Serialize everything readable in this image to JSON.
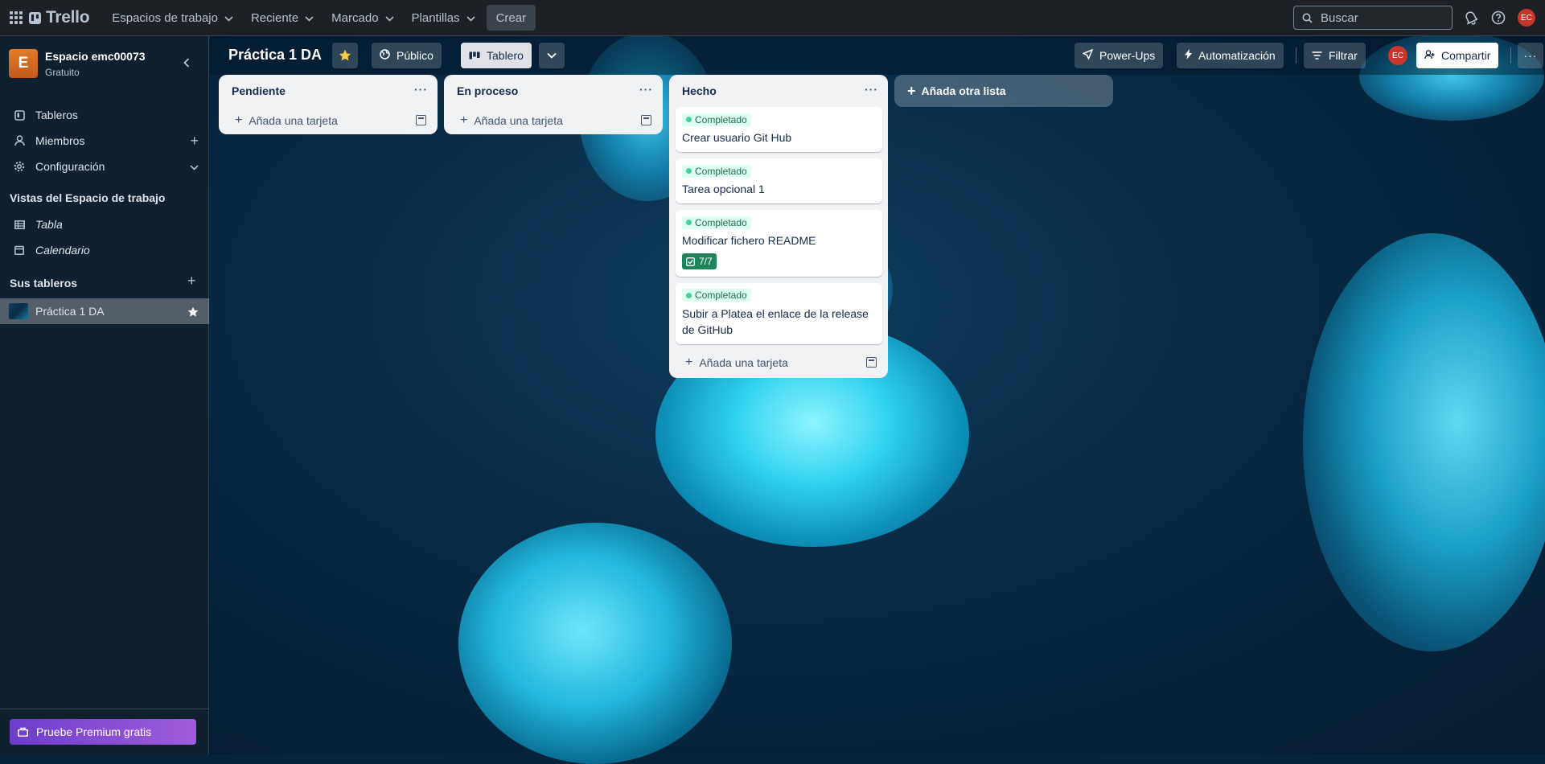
{
  "topnav": {
    "logo": "Trello",
    "menus": [
      "Espacios de trabajo",
      "Reciente",
      "Marcado",
      "Plantillas"
    ],
    "create_label": "Crear",
    "search_placeholder": "Buscar",
    "user_initials": "EC"
  },
  "sidebar": {
    "workspace_initial": "E",
    "workspace_name": "Espacio emc00073",
    "workspace_plan": "Gratuito",
    "items": [
      {
        "label": "Tableros",
        "icon": "board-icon"
      },
      {
        "label": "Miembros",
        "icon": "person-icon"
      },
      {
        "label": "Configuración",
        "icon": "gear-icon"
      }
    ],
    "views_heading": "Vistas del Espacio de trabajo",
    "views": [
      {
        "label": "Tabla",
        "icon": "table-icon"
      },
      {
        "label": "Calendario",
        "icon": "calendar-icon"
      }
    ],
    "boards_heading": "Sus tableros",
    "boards": [
      {
        "label": "Práctica 1 DA",
        "starred": true
      }
    ],
    "premium_label": "Pruebe Premium gratis"
  },
  "board": {
    "title": "Práctica 1 DA",
    "visibility_label": "Público",
    "view_label": "Tablero",
    "powerups_label": "Power-Ups",
    "automation_label": "Automatización",
    "filter_label": "Filtrar",
    "share_label": "Compartir",
    "member_initials": "EC",
    "add_list_label": "Añada otra lista",
    "add_card_label": "Añada una tarjeta",
    "lists": [
      {
        "title": "Pendiente",
        "cards": []
      },
      {
        "title": "En proceso",
        "cards": []
      },
      {
        "title": "Hecho",
        "cards": [
          {
            "label": "Completado",
            "title": "Crear usuario Git Hub"
          },
          {
            "label": "Completado",
            "title": "Tarea opcional 1"
          },
          {
            "label": "Completado",
            "title": "Modificar fichero README",
            "checklist": "7/7"
          },
          {
            "label": "Completado",
            "title": "Subir a Platea el enlace de la release de GitHub"
          }
        ]
      }
    ]
  },
  "colors": {
    "nav_bg": "#1d2125",
    "label_green": "#4bce97",
    "checklist_green": "#1f845a",
    "avatar_red": "#c9372c",
    "premium_purple": "#8a4fd3"
  }
}
